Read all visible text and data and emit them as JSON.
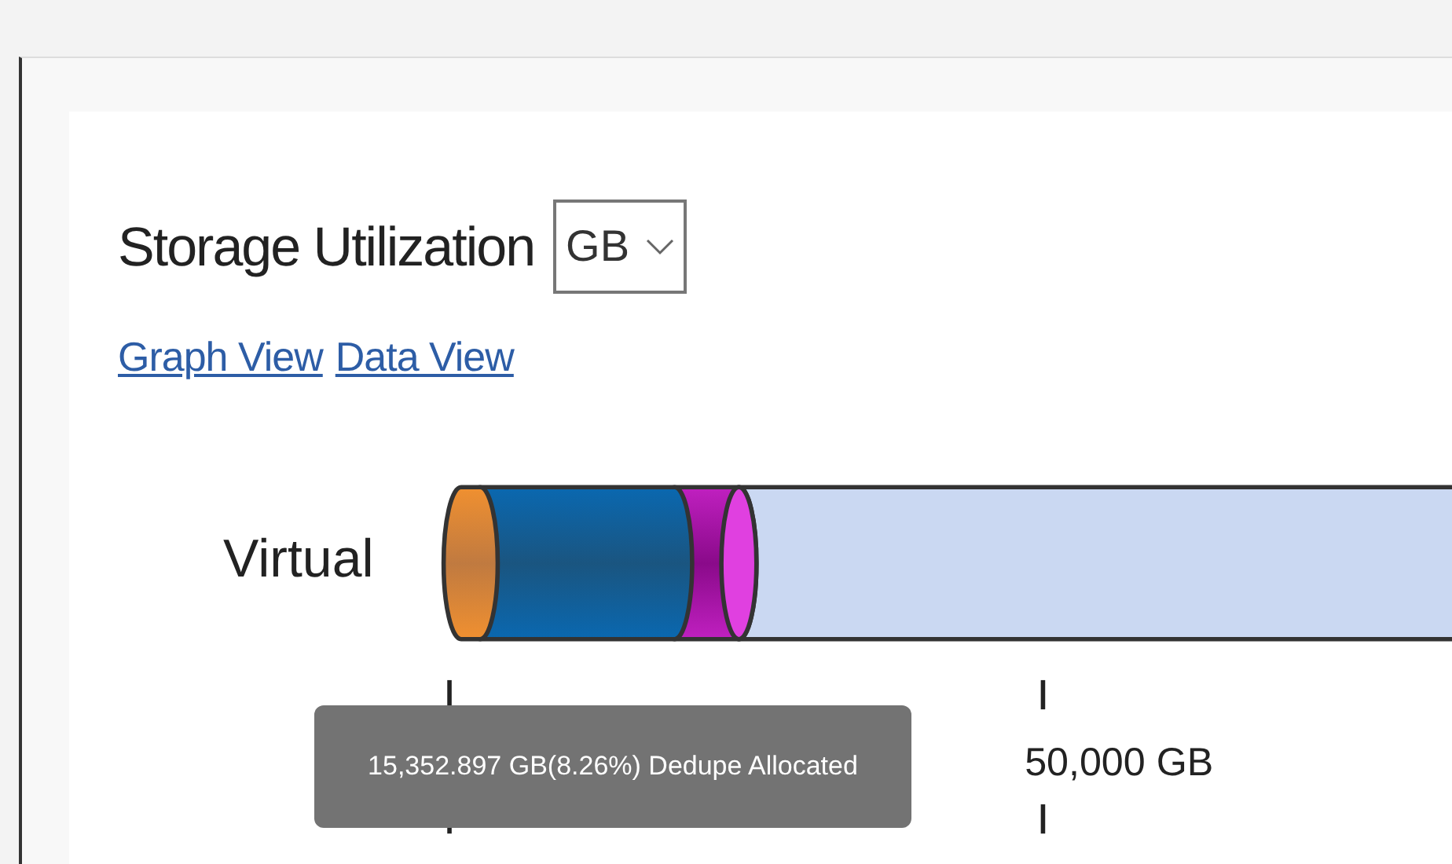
{
  "title": "Storage Utilization",
  "unit_select": {
    "value": "GB"
  },
  "views": [
    {
      "label": "Graph View"
    },
    {
      "label": "Data View"
    }
  ],
  "chart": {
    "row_label": "Virtual",
    "axis_label": "50,000 GB"
  },
  "tooltip": "15,352.897 GB(8.26%) Dedupe Allocated"
}
